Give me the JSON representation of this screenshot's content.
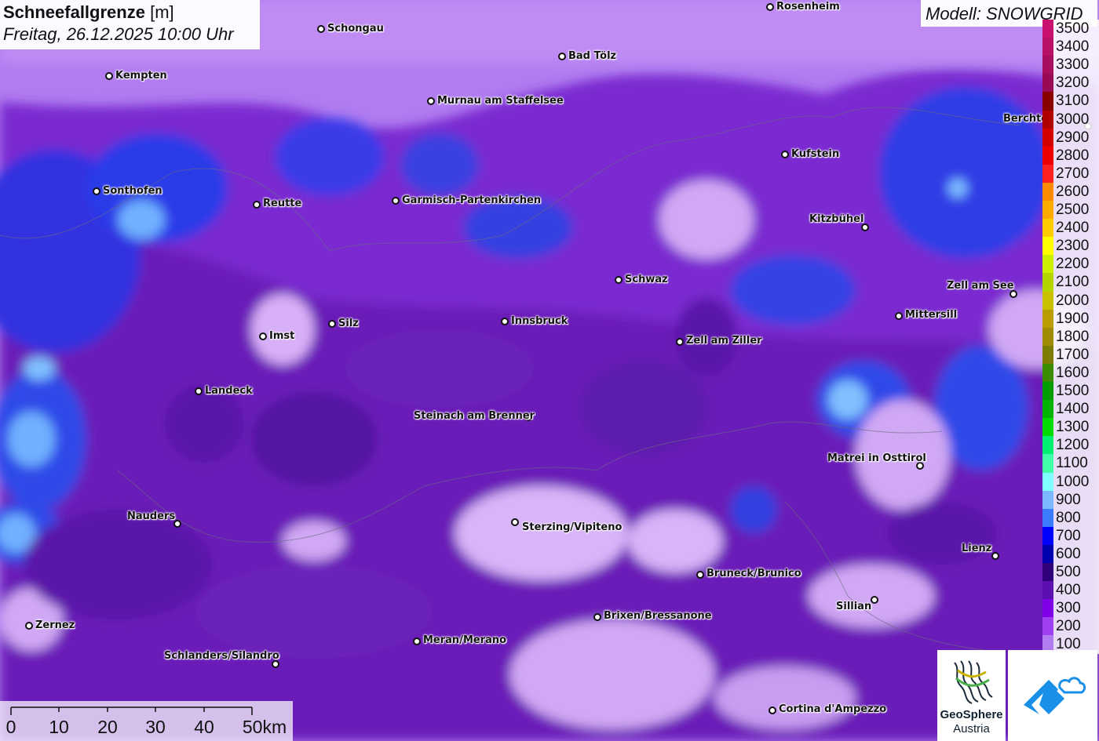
{
  "title": {
    "parameter": "Schneefallgrenze",
    "unit": "[m]",
    "datetime": "Freitag, 26.12.2025 10:00 Uhr"
  },
  "model_label": "Modell: SNOWGRID",
  "legend": {
    "levels": [
      "3500",
      "3400",
      "3300",
      "3200",
      "3100",
      "3000",
      "2900",
      "2800",
      "2700",
      "2600",
      "2500",
      "2400",
      "2300",
      "2200",
      "2100",
      "2000",
      "1900",
      "1800",
      "1700",
      "1600",
      "1500",
      "1400",
      "1300",
      "1200",
      "1100",
      "1000",
      "900",
      "800",
      "700",
      "600",
      "500",
      "400",
      "300",
      "200",
      "100"
    ],
    "colors": [
      "#c8106e",
      "#b81064",
      "#a80c5c",
      "#980a54",
      "#8a0000",
      "#b00000",
      "#d40000",
      "#ee0000",
      "#ff2020",
      "#ff8c00",
      "#ffaa00",
      "#ffcc00",
      "#ffff00",
      "#ccee00",
      "#b4d400",
      "#c8c000",
      "#b89c00",
      "#a08c00",
      "#7c7c00",
      "#3c8c00",
      "#009c00",
      "#00b400",
      "#00dc00",
      "#00f070",
      "#40ffa8",
      "#80ffff",
      "#7cb8ff",
      "#3c7cff",
      "#0000ff",
      "#0000b0",
      "#30007c",
      "#5c10b0",
      "#8000e8",
      "#a040f0",
      "#b07cf0"
    ]
  },
  "cities": [
    {
      "name": "Rosenheim"
    },
    {
      "name": "Schongau"
    },
    {
      "name": "Kempten"
    },
    {
      "name": "Bad Tölz"
    },
    {
      "name": "Murnau am Staffelsee"
    },
    {
      "name": "Berchte"
    },
    {
      "name": "Kufstein"
    },
    {
      "name": "Sonthofen"
    },
    {
      "name": "Reutte"
    },
    {
      "name": "Garmisch-Partenkirchen"
    },
    {
      "name": "Kitzbühel"
    },
    {
      "name": "Schwaz"
    },
    {
      "name": "Zell am See"
    },
    {
      "name": "Mittersill"
    },
    {
      "name": "Imst"
    },
    {
      "name": "Silz"
    },
    {
      "name": "Innsbruck"
    },
    {
      "name": "Zell am Ziller"
    },
    {
      "name": "Landeck"
    },
    {
      "name": "Steinach am Brenner"
    },
    {
      "name": "Matrei in Osttirol"
    },
    {
      "name": "Nauders"
    },
    {
      "name": "Sterzing/Vipiteno"
    },
    {
      "name": "Lienz"
    },
    {
      "name": "Bruneck/Brunico"
    },
    {
      "name": "Sillian"
    },
    {
      "name": "Brixen/Bressanone"
    },
    {
      "name": "Zernez"
    },
    {
      "name": "Meran/Merano"
    },
    {
      "name": "Schlanders/Silandro"
    },
    {
      "name": "Cortina d'Ampezzo"
    }
  ],
  "scale_bar": {
    "labels": [
      "0",
      "10",
      "20",
      "30",
      "40",
      "50km"
    ]
  },
  "logos": {
    "geosphere_line1": "GeoSphere",
    "geosphere_line2": "Austria",
    "geosphere_icon": "geosphere-logo-icon",
    "snowgrid_icon": "mountain-cloud-icon"
  }
}
